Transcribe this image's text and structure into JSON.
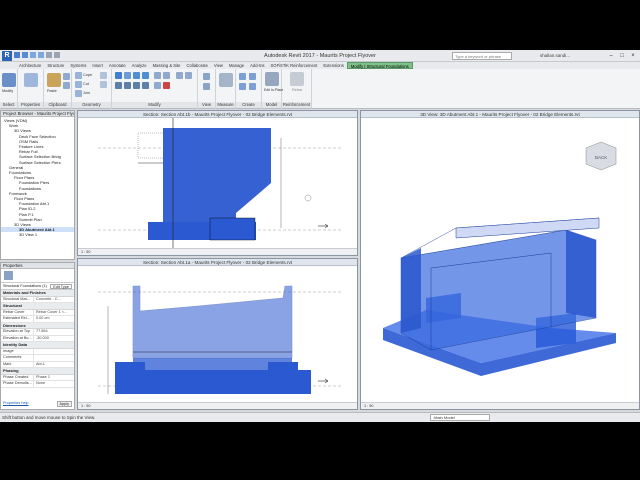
{
  "app": {
    "title": "Autodesk Revit 2017 -   Maurits Project Flyover",
    "logo": "R",
    "search_placeholder": "Type a keyword or phrase",
    "user": "shallan.sandi..."
  },
  "tabs": [
    "Architecture",
    "Structure",
    "Systems",
    "Insert",
    "Annotate",
    "Analyze",
    "Massing & Site",
    "Collaborate",
    "View",
    "Manage",
    "Add-Ins",
    "SOFiSTiK Reinforcement",
    "Extensions",
    "Modify | Structural Foundations"
  ],
  "ribbon": {
    "groups": [
      "Select",
      "Properties",
      "Clipboard",
      "Geometry",
      "Modify",
      "View",
      "Measure",
      "Create",
      "Model",
      "Reinforcement"
    ],
    "modify_label": "Modify",
    "edit_inplace_label": "Edit In-Place",
    "rebar_label": "Rebar",
    "paste_label": "Paste",
    "cope_label": "Cope",
    "cut_label": "Cut",
    "join_label": "Join"
  },
  "browser": {
    "title": "Project Browser - Maurits Project Flyo...",
    "items": [
      {
        "label": "Views (VDM)",
        "indent": 0
      },
      {
        "label": "Work",
        "indent": 1
      },
      {
        "label": "3D Views",
        "indent": 2
      },
      {
        "label": "Deck Face Selection",
        "indent": 3
      },
      {
        "label": "OSM Rails",
        "indent": 3
      },
      {
        "label": "Feature Lines",
        "indent": 3
      },
      {
        "label": "Rebar Full",
        "indent": 3
      },
      {
        "label": "Surface Selection Bridg",
        "indent": 3
      },
      {
        "label": "Surface Selection Piers",
        "indent": 3
      },
      {
        "label": "General",
        "indent": 1
      },
      {
        "label": "Foundations",
        "indent": 1
      },
      {
        "label": "Floor Plans",
        "indent": 2
      },
      {
        "label": "Foundation Piers",
        "indent": 3
      },
      {
        "label": "Foundations",
        "indent": 3
      },
      {
        "label": "Formwork",
        "indent": 1
      },
      {
        "label": "Floor Plans",
        "indent": 2
      },
      {
        "label": "Foundation Abt.1",
        "indent": 3
      },
      {
        "label": "Plan ID.2",
        "indent": 3
      },
      {
        "label": "Plan P.1",
        "indent": 3
      },
      {
        "label": "Summit Plan",
        "indent": 3
      },
      {
        "label": "3D Views",
        "indent": 2
      },
      {
        "label": "3D Abutment Abt.1",
        "indent": 3,
        "bold": true
      },
      {
        "label": "3D View 1",
        "indent": 3
      }
    ]
  },
  "properties": {
    "title": "Properties",
    "type_name": "Structural Foundations (1)",
    "edit_type": "Edit Type",
    "rows": [
      {
        "cat": "Materials and Finishes"
      },
      {
        "k": "Structural Mat...",
        "v": "Concrete - C..."
      },
      {
        "cat": "Structural"
      },
      {
        "k": "Rebar Cover",
        "v": "Rebar Cover 1 <..."
      },
      {
        "k": "Estimated Rei...",
        "v": "0.00 cm"
      },
      {
        "cat": "Dimensions"
      },
      {
        "k": "Elevation at Top",
        "v": "77.564"
      },
      {
        "k": "Elevation at Bo...",
        "v": "-30.000"
      },
      {
        "cat": "Identity Data"
      },
      {
        "k": "Image",
        "v": ""
      },
      {
        "k": "Comments",
        "v": ""
      },
      {
        "k": "Mark",
        "v": "Abt.1"
      },
      {
        "cat": "Phasing"
      },
      {
        "k": "Phase Created",
        "v": "Phase 1"
      },
      {
        "k": "Phase Demolis...",
        "v": "None"
      }
    ],
    "help_link": "Properties help",
    "apply": "Apply"
  },
  "views": {
    "top_left": {
      "title": "Section: Section Abt.1b - Maurits Project Flyover - 02 Bridge Elements.rvt",
      "scale": "1 : 50"
    },
    "bottom_left": {
      "title": "Section: Section Abt.1a - Maurits Project Flyover - 02 Bridge Elements.rvt",
      "scale": "1 : 50"
    },
    "right": {
      "title": "3D View: 3D Abutment Abt.1 - Maurits Project Flyover - 02 Bridge Elements.rvt",
      "scale": "1 : 50"
    },
    "viewcube_label": "BACK"
  },
  "status": {
    "text": "Shift button and move mouse to Spin the View.",
    "model": ":Main Model"
  },
  "colors": {
    "accent_green": "#7ec18a",
    "foundation_blue": "#2b59d1"
  }
}
